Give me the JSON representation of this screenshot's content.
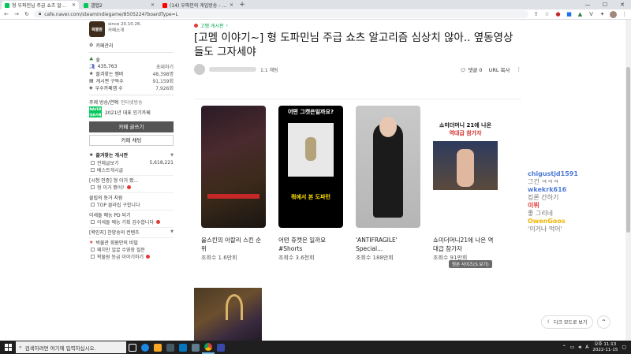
{
  "browser": {
    "tabs": [
      {
        "label": "형 우파민님 주급 쇼츠 알고리즘",
        "color": "#03c75a",
        "active": true
      },
      {
        "label": "갤탭2",
        "color": "#03c75a",
        "active": false
      },
      {
        "label": "(14) 우파민의 게임방송 - YouTube",
        "color": "#ff0000",
        "active": false
      }
    ],
    "url": "cafe.naver.com/steamindiegame/8505224?boardType=L"
  },
  "sidebar": {
    "cafe_since": "since 20.10.26.",
    "cafe_intro": "카페소개",
    "cafe_manage": "카페관리",
    "level_label": "숲",
    "member_count": "435,763",
    "invite": "초대하기",
    "stats": [
      {
        "label": "즐겨찾는 멤버",
        "value": "48,398명"
      },
      {
        "label": "게시판 구독수",
        "value": "91,159회"
      },
      {
        "label": "우수카페앱 수",
        "value": "7,926회"
      }
    ],
    "theme": "주제 방송/연예",
    "theme_link": "인터넷방송",
    "badge_label": "2021년 대표 인기카페",
    "badge_line1": "NAVER",
    "badge_line2": "대표카페",
    "write_button": "카페 글쓰기",
    "chat_button": "카페 채팅",
    "favorites_title": "즐겨찾는 게시판",
    "boards": [
      {
        "label": "전체글보기",
        "value": "5,618,221",
        "new": false
      },
      {
        "label": "베스트게시글",
        "value": "",
        "new": false
      }
    ],
    "group1": "[시청 인증] 형 이거 봤...",
    "group1_items": [
      {
        "label": "형 이거 봤어?",
        "new": true
      }
    ],
    "group2": "클립의 동거 지원",
    "group2_items": [
      {
        "label": "TOP 클라립 구합니다",
        "new": false
      }
    ],
    "group3": "이세돌 예능 PD 되기",
    "group3_items": [
      {
        "label": "이세돌 예능 기획 검수합니다",
        "new": true
      }
    ],
    "group4": "[왁인지] 찬양송의 컨텐츠",
    "group5": "박물관 회원만의 비밀",
    "group5_items": [
      {
        "label": "왜치만 얼굴 수영장 질문",
        "new": false
      },
      {
        "label": "왁물원 등급 이야기하기",
        "new": true
      }
    ]
  },
  "article": {
    "board": "고멤 게시판",
    "title": "[고멤 이야기~] 형 도파민님 주급 쇼츠 알고리즘 심상치 않아.. 옆동영상들도 그자세야",
    "level": "1:1 채팅",
    "comments": "댓글 0",
    "url_copy": "URL 복사",
    "more": "⋮",
    "tooltip": "원본 사이즈(S 보기)"
  },
  "videos": [
    {
      "title": "울스킨의 아칼리 스킨 순위",
      "views": "조회수 1.6만회",
      "caption_top": "",
      "caption_bottom": ""
    },
    {
      "title": "어떤 휴캣은 일까요 #Shorts",
      "views": "조회수 3.6천회",
      "caption_top": "어떤 그캣은일까요?",
      "caption_bottom": "뭐에서 본 도파민"
    },
    {
      "title": "'ANTIFRAGILE' Special...",
      "views": "조회수 188만회",
      "caption_top": "",
      "caption_bottom": ""
    },
    {
      "title": "쇼미더머니21에 나온 역대급 참가자",
      "views": "조회수 91만회",
      "caption_top": "쇼미더머니 21에 나온",
      "caption_red": "역대급 참가자"
    }
  ],
  "chat": [
    {
      "name": "chigustjd1591",
      "msg": "그건 ㅋㅋㅋ",
      "color": "#4e7bd6"
    },
    {
      "name": "wkekrk616",
      "msg": "킹론 간하기",
      "color": "#4e7bd6"
    },
    {
      "name": "이뷔",
      "msg": "좋 그리네",
      "color": "#e53935"
    },
    {
      "name": "OwenGoos",
      "msg": "'이거나 먹어'",
      "color": "#f0b400"
    }
  ],
  "floating": {
    "dark_mode": "다크 모드로 보기",
    "top_button": "⌃"
  },
  "taskbar": {
    "search_placeholder": "검색하려면 여기에 입력하십시오.",
    "time": "오후 11:13",
    "date": "2022-11-15",
    "ime": "A"
  }
}
